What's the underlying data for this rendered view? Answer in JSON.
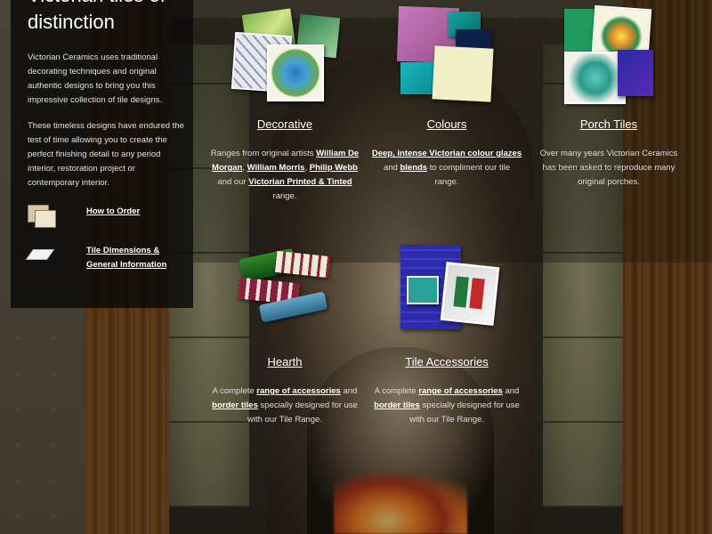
{
  "panel": {
    "title": "Victorian tiles of distinction",
    "intro": "Victorian Ceramics uses traditional decorating techniques and original authentic designs to bring you this impressive collection of tile designs.",
    "intro2": "These timeless designs have endured the test of time allowing you to create the perfect finishing detail to any period interior, restoration project or contemporary interior.",
    "links": [
      {
        "label": "How to Order",
        "icon": "box-stack-icon"
      },
      {
        "label": "Tile Dimensions & General Information",
        "icon": "tile-slab-icon"
      }
    ]
  },
  "cards": {
    "decorative": {
      "title": "Decorative",
      "desc_a": "Ranges from original artists ",
      "link_de_morgan": "William De Morgan",
      "sep1": ", ",
      "link_morris": "William Morris",
      "sep2": ", ",
      "link_webb": "Philip Webb",
      "desc_b": " and our ",
      "link_printed": "Victorian Printed & Tinted",
      "desc_c": " range."
    },
    "colours": {
      "title": "Colours",
      "link_glazes": "Deep, intense Victorian colour glazes",
      "desc_a": " and ",
      "link_blends": "blends",
      "desc_b": " to compliment our tile range."
    },
    "porch": {
      "title": "Porch Tiles",
      "desc": "Over many years Victorian Ceramics has been asked to reproduce many original porches."
    },
    "hearth": {
      "title": "Hearth",
      "desc_a": "A complete ",
      "link_range": "range of accessories",
      "desc_b": " and ",
      "link_border": "border tiles",
      "desc_c": " specially designed for use with our Tile Range."
    },
    "accessories": {
      "title": "Tile Accessories",
      "desc_a": "A complete ",
      "link_range": "range of accessories",
      "desc_b": " and ",
      "link_border": "border tiles",
      "desc_c": " specially designed for use with our Tile Range."
    }
  }
}
